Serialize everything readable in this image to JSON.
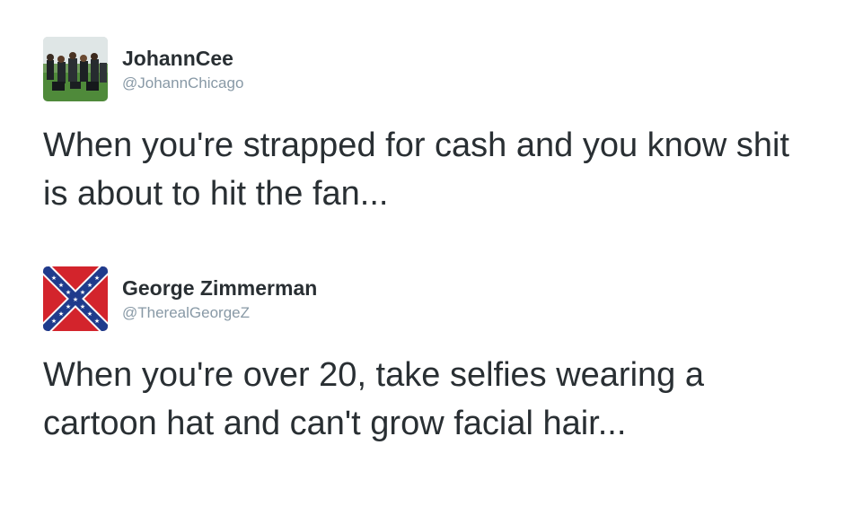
{
  "tweets": [
    {
      "display_name": "JohannCee",
      "handle": "@JohannChicago",
      "avatar_icon": "team-photo-avatar",
      "text": "When you're strapped for cash and you know shit is about to hit the fan..."
    },
    {
      "display_name": "George Zimmerman",
      "handle": "@TherealGeorgeZ",
      "avatar_icon": "confederate-flag-avatar",
      "text": "When you're over 20, take selfies wearing a cartoon hat and can't grow facial hair..."
    }
  ],
  "colors": {
    "text": "#292f33",
    "handle": "#8899a6",
    "background": "#ffffff"
  }
}
